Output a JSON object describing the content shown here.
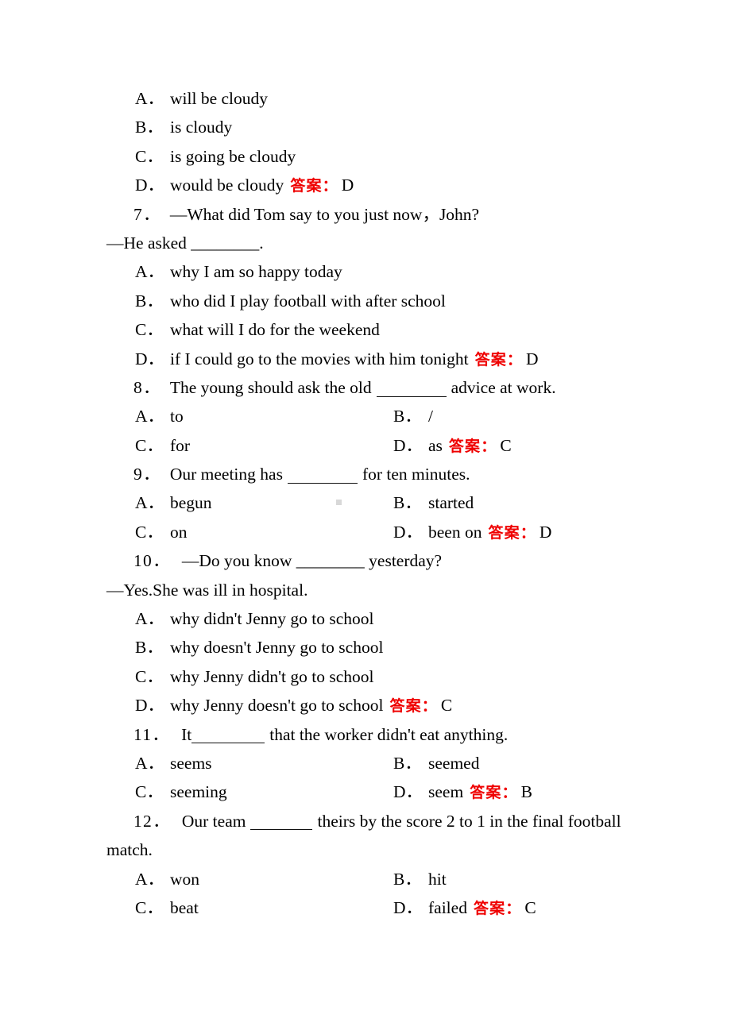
{
  "document": {
    "type": "english-grammar-multiple-choice-worksheet",
    "answer_label": "答案：",
    "answer_color": "#ef0000",
    "page_background": "#ffffff"
  },
  "carryover_options": {
    "note": "options of question 6 continued from previous page",
    "items": [
      {
        "label": "A．",
        "text": "will be cloudy"
      },
      {
        "label": "B．",
        "text": "is cloudy"
      },
      {
        "label": "C．",
        "text": "is going be cloudy"
      },
      {
        "label": "D．",
        "text": "would be cloudy"
      }
    ],
    "answer": "D"
  },
  "questions": [
    {
      "number": "7．",
      "layout": "stacked",
      "stem_lines": [
        "—What did Tom say to you just now，John?",
        "—He asked ________."
      ],
      "options": [
        {
          "label": "A．",
          "text": "why I am so happy today"
        },
        {
          "label": "B．",
          "text": "who did I play football with after school"
        },
        {
          "label": "C．",
          "text": "what will I do for the weekend"
        },
        {
          "label": "D．",
          "text": "if I could go to the movies with him tonight"
        }
      ],
      "answer": "D"
    },
    {
      "number": "8．",
      "layout": "two-column",
      "stem_pre": "The young should ask the old",
      "stem_post": "advice at work.",
      "options": [
        {
          "label": "A．",
          "text": "to"
        },
        {
          "label": "B．",
          "text": "/"
        },
        {
          "label": "C．",
          "text": "for"
        },
        {
          "label": "D．",
          "text": "as"
        }
      ],
      "answer": "C"
    },
    {
      "number": "9．",
      "layout": "two-column",
      "stem_pre": "Our meeting has",
      "stem_post": "for ten minutes.",
      "options": [
        {
          "label": "A．",
          "text": "begun"
        },
        {
          "label": "B．",
          "text": "started"
        },
        {
          "label": "C．",
          "text": "on"
        },
        {
          "label": "D．",
          "text": "been on"
        }
      ],
      "answer": "D"
    },
    {
      "number": "10．",
      "layout": "stacked",
      "stem_lines": [
        "—Do you know ________ yesterday?",
        "—Yes.She was ill in hospital."
      ],
      "options": [
        {
          "label": "A．",
          "text": "why didn't Jenny go to school"
        },
        {
          "label": "B．",
          "text": "why doesn't Jenny go to school"
        },
        {
          "label": "C．",
          "text": "why Jenny didn't go to school"
        },
        {
          "label": "D．",
          "text": "why Jenny doesn't go to school"
        }
      ],
      "answer": "C"
    },
    {
      "number": "11．",
      "layout": "two-column",
      "stem_pre": "It",
      "stem_post": "that the worker didn't eat anything.",
      "options": [
        {
          "label": "A．",
          "text": "seems"
        },
        {
          "label": "B．",
          "text": "seemed"
        },
        {
          "label": "C．",
          "text": "seeming"
        },
        {
          "label": "D．",
          "text": "seem"
        }
      ],
      "answer": "B"
    },
    {
      "number": "12．",
      "layout": "two-column",
      "stem_pre": "Our team",
      "stem_post": "theirs by the score 2 to 1 in the final football",
      "stem_wrap": "match.",
      "options": [
        {
          "label": "A．",
          "text": "won"
        },
        {
          "label": "B．",
          "text": "hit"
        },
        {
          "label": "C．",
          "text": "beat"
        },
        {
          "label": "D．",
          "text": "failed"
        }
      ],
      "answer": "C"
    }
  ]
}
